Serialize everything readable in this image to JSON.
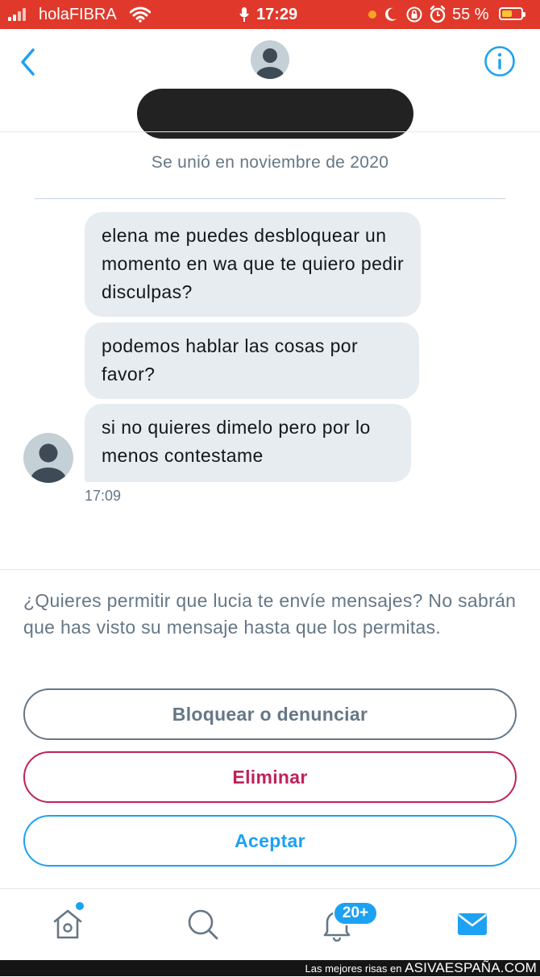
{
  "status_bar": {
    "carrier": "holaFIBRA",
    "time": "17:29",
    "battery_percent": "55 %",
    "battery_level": 0.55,
    "icons": [
      "signal-icon",
      "wifi-icon",
      "mic-icon",
      "orange-dot",
      "moon-icon",
      "rotation-lock-icon",
      "alarm-icon",
      "battery-icon"
    ]
  },
  "header": {
    "icons": [
      "back-chevron-icon",
      "avatar-placeholder",
      "info-icon"
    ],
    "joined_text": "Se unió en noviembre de 2020"
  },
  "messages": [
    {
      "text": "elena me puedes desbloquear un momento en wa que te quiero pedir disculpas?"
    },
    {
      "text": "podemos hablar las cosas por favor?"
    },
    {
      "text": "si no quieres dimelo pero por lo menos contestame"
    }
  ],
  "message_time": "17:09",
  "request": {
    "text": "¿Quieres permitir que lucia te envíe mensajes? No sabrán que has visto su mensaje hasta que los permitas.",
    "block_label": "Bloquear o denunciar",
    "delete_label": "Eliminar",
    "accept_label": "Aceptar"
  },
  "tabs": {
    "notifications_badge": "20+",
    "icons": [
      "home-icon",
      "search-icon",
      "bell-icon",
      "mail-icon"
    ]
  },
  "watermark": {
    "prefix": "Las mejores risas en",
    "brand": "ASIVAESPAÑA.COM"
  },
  "colors": {
    "status_bar": "#e0392b",
    "accent": "#1da1f2",
    "danger": "#c0215a",
    "muted": "#657786",
    "bubble": "#e6ecf0"
  }
}
